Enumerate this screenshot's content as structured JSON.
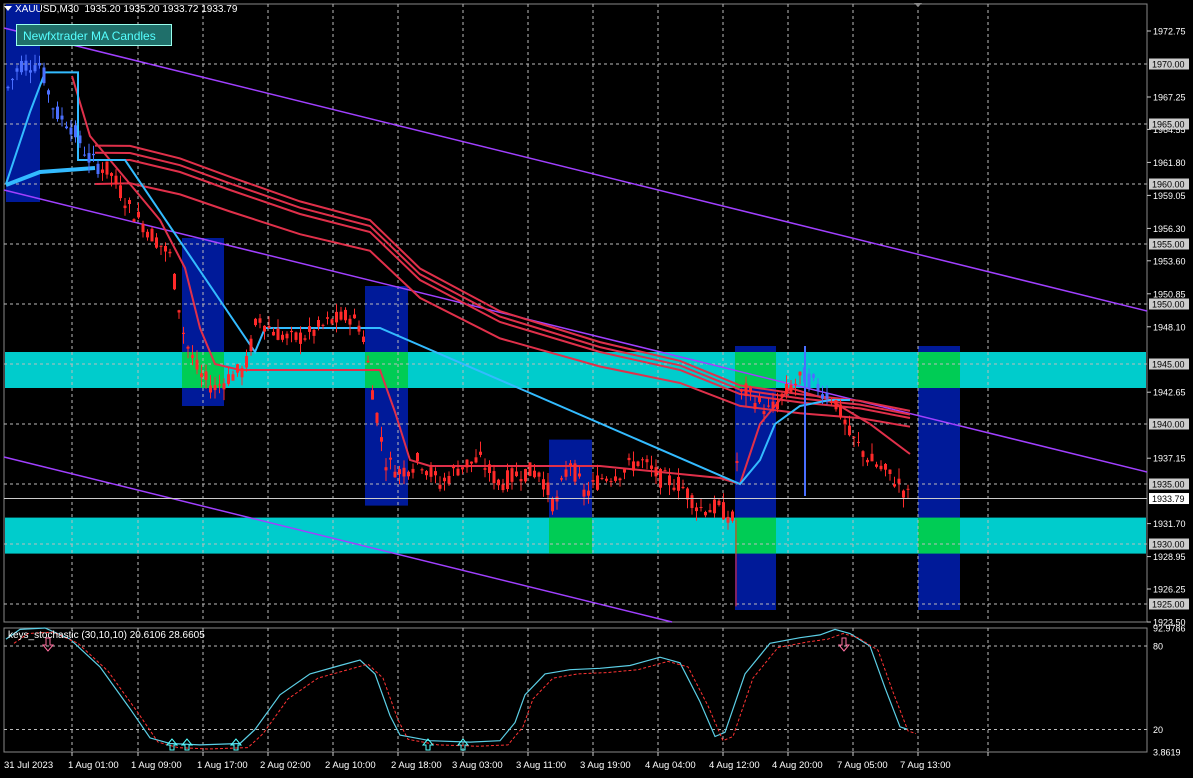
{
  "header": {
    "symbol": "XAUUSD,M30",
    "ohlc": "1935.20 1935.20 1933.72 1933.79"
  },
  "indicator_button": {
    "label": "Newfxtrader MA Candles"
  },
  "subwindow": {
    "label": "keys_stochastic (30,10,10) 20.6106 28.6605",
    "axis_labels": [
      "92.9786",
      "80",
      "20",
      "3.8619"
    ]
  },
  "price_axis": {
    "labels": [
      "1972.75",
      "1967.25",
      "1964.55",
      "1961.80",
      "1959.05",
      "1956.30",
      "1953.60",
      "1950.85",
      "1948.10",
      "1942.65",
      "1937.15",
      "1931.70",
      "1928.95",
      "1926.25",
      "1923.50"
    ],
    "boxed_labels": [
      "1970.00",
      "1965.00",
      "1960.00",
      "1955.00",
      "1950.00",
      "1945.00",
      "1940.00",
      "1935.00",
      "1930.00",
      "1925.00"
    ],
    "current_price": "1933.79"
  },
  "time_axis": {
    "labels": [
      "31 Jul 2023",
      "1 Aug 01:00",
      "1 Aug 09:00",
      "1 Aug 17:00",
      "2 Aug 02:00",
      "2 Aug 10:00",
      "2 Aug 18:00",
      "3 Aug 03:00",
      "3 Aug 11:00",
      "3 Aug 19:00",
      "4 Aug 04:00",
      "4 Aug 12:00",
      "4 Aug 20:00",
      "7 Aug 05:00",
      "7 Aug 13:00"
    ]
  },
  "colors": {
    "background": "#000000",
    "candles": "#ff2a2a",
    "candles_bull_start": "#4a6fff",
    "fast_ma": "#33bbff",
    "slow_mas": "#e0304a",
    "channel_lines": "#a040ff",
    "zone": "#00cccc",
    "zone_green": "#00cc55",
    "box": "#001a99"
  }
}
